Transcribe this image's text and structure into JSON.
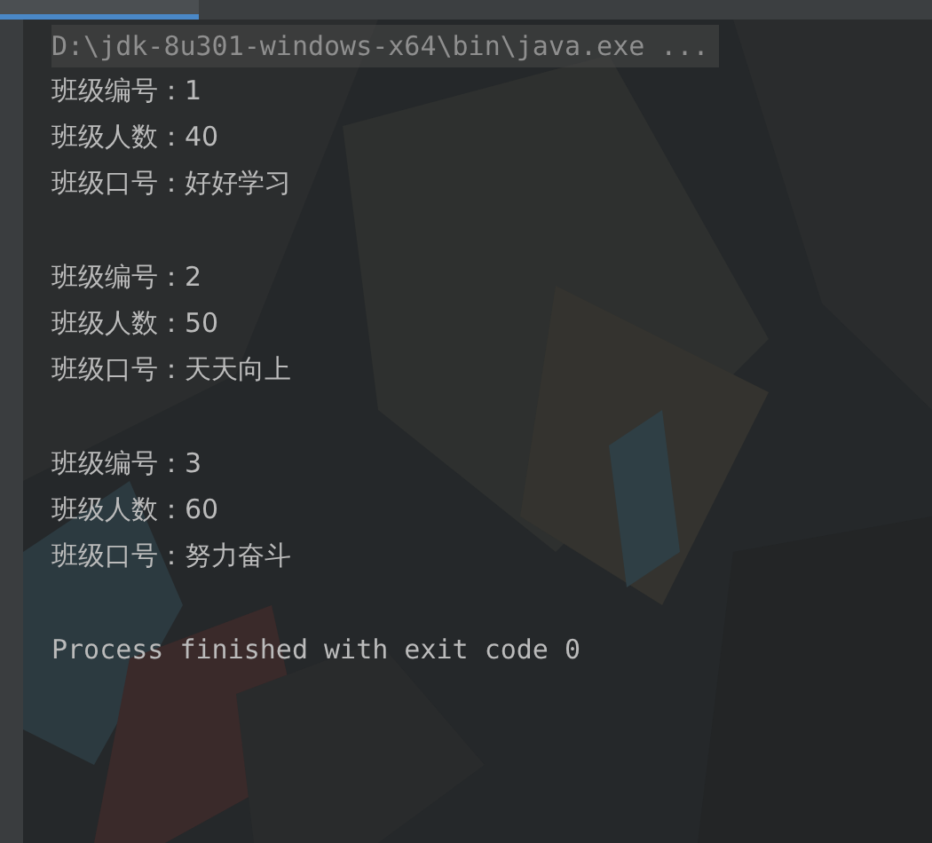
{
  "console": {
    "command": "D:\\jdk-8u301-windows-x64\\bin\\java.exe ...",
    "blocks": [
      {
        "lines": [
          "班级编号：1",
          "班级人数：40",
          "班级口号：好好学习"
        ]
      },
      {
        "lines": [
          "班级编号：2",
          "班级人数：50",
          "班级口号：天天向上"
        ]
      },
      {
        "lines": [
          "班级编号：3",
          "班级人数：60",
          "班级口号：努力奋斗"
        ]
      }
    ],
    "exit_message": "Process finished with exit code 0"
  }
}
